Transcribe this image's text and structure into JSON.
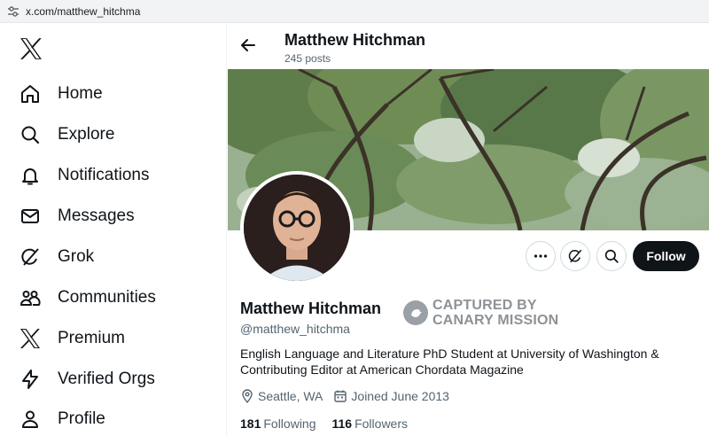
{
  "browser": {
    "url": "x.com/matthew_hitchma"
  },
  "sidebar": {
    "logo_icon": "x-logo-icon",
    "items": [
      {
        "label": "Home",
        "icon": "home-icon"
      },
      {
        "label": "Explore",
        "icon": "search-icon"
      },
      {
        "label": "Notifications",
        "icon": "bell-icon"
      },
      {
        "label": "Messages",
        "icon": "mail-icon"
      },
      {
        "label": "Grok",
        "icon": "grok-icon"
      },
      {
        "label": "Communities",
        "icon": "communities-icon"
      },
      {
        "label": "Premium",
        "icon": "x-logo-icon"
      },
      {
        "label": "Verified Orgs",
        "icon": "lightning-icon"
      },
      {
        "label": "Profile",
        "icon": "person-icon"
      }
    ]
  },
  "header": {
    "name": "Matthew Hitchman",
    "posts": "245 posts"
  },
  "profile": {
    "name": "Matthew Hitchman",
    "handle": "@matthew_hitchma",
    "bio": "English Language and Literature PhD Student at University of Washington & Contributing Editor at American Chordata Magazine",
    "location": "Seattle, WA",
    "joined": "Joined June 2013",
    "following_count": "181",
    "following_label": "Following",
    "followers_count": "116",
    "followers_label": "Followers"
  },
  "actions": {
    "follow_label": "Follow",
    "more_icon": "more-icon",
    "grok_icon": "grok-icon",
    "search_icon": "search-icon"
  },
  "stamp": {
    "line1": "CAPTURED BY",
    "line2": "CANARY MISSION"
  },
  "colors": {
    "accent_dark": "#0f1419",
    "secondary_text": "#536471",
    "border": "#cfd9de",
    "stamp_gray": "#8e9297"
  }
}
